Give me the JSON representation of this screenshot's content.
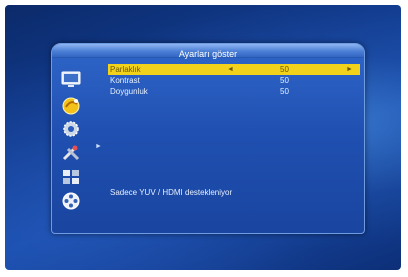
{
  "dialog": {
    "title": "Ayarları göster",
    "rows": [
      {
        "label": "Parlaklık",
        "value": "50",
        "arrow_left": "◄",
        "arrow_right": "►"
      },
      {
        "label": "Kontrast",
        "value": "50"
      },
      {
        "label": "Doygunluk",
        "value": "50"
      }
    ],
    "note": "Sadece YUV / HDMI destekleniyor"
  },
  "sidebar": {
    "icons": [
      "tv-icon",
      "satellite-dish-icon",
      "settings-gear-icon",
      "tools-icon",
      "sliders-icon",
      "media-reel-icon"
    ],
    "expand_arrow": "►"
  },
  "colors": {
    "highlight": "#f2d21a",
    "dialog_blue": "#1f4fb0",
    "background_blue": "#123c8f"
  }
}
